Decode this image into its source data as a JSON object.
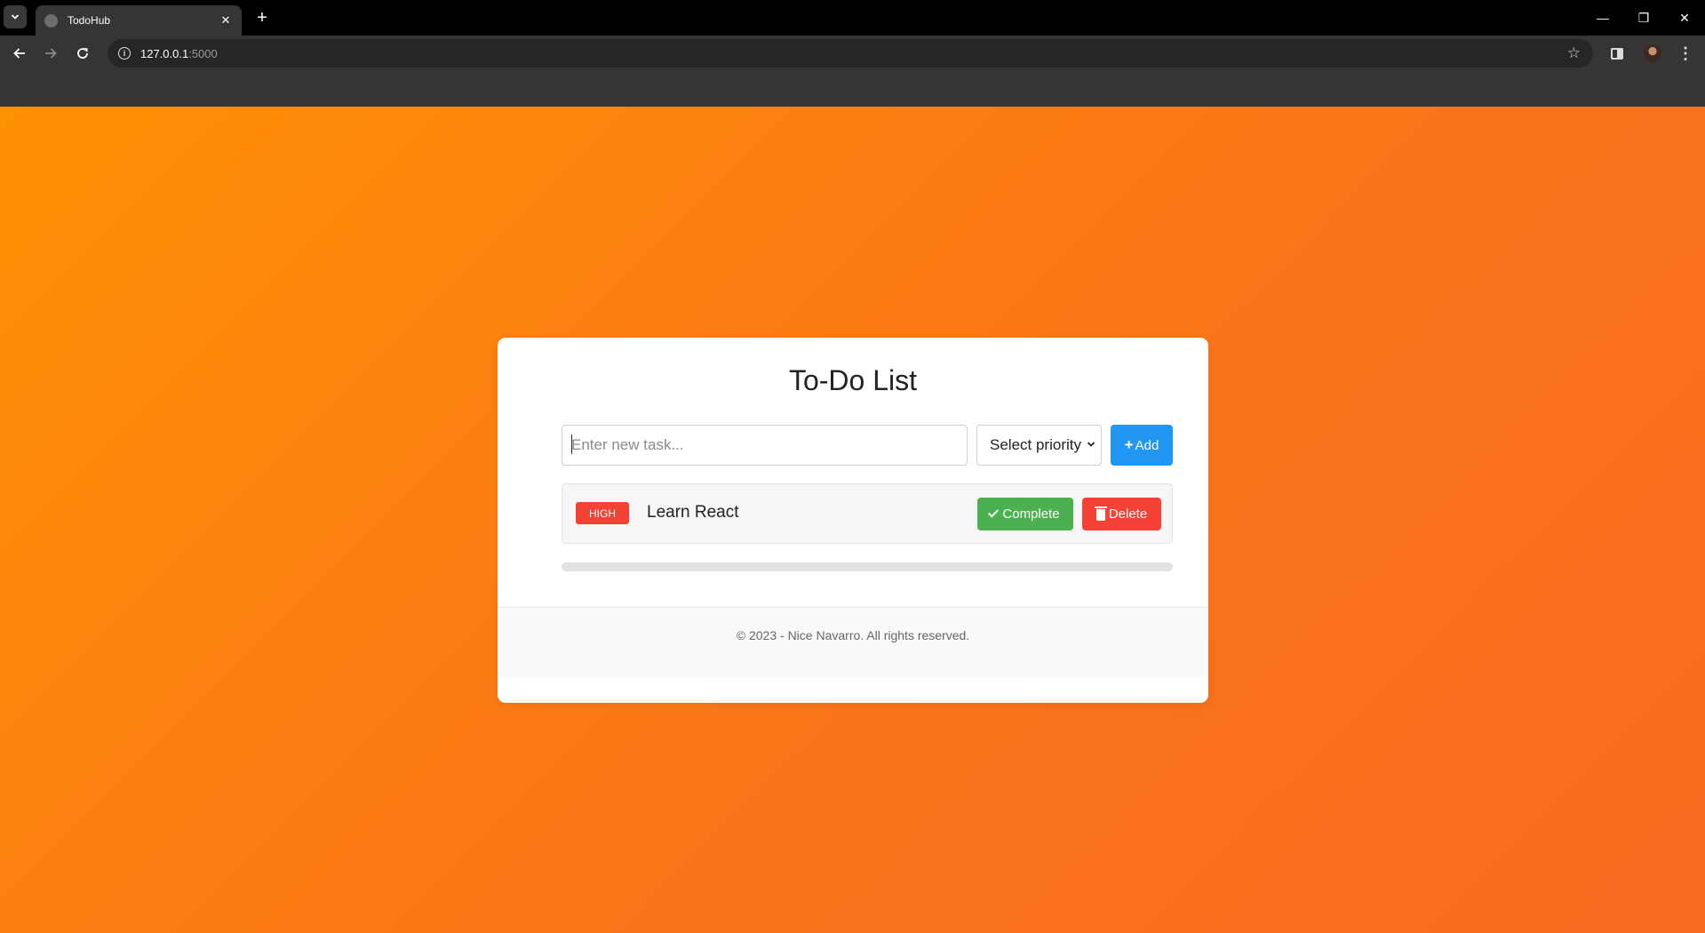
{
  "browser": {
    "tab_title": "TodoHub",
    "url_host": "127.0.0.1",
    "url_port": ":5000"
  },
  "app": {
    "title": "To-Do List",
    "task_input_placeholder": "Enter new task...",
    "priority_select_value": "Select priority",
    "add_label": "Add",
    "tasks": [
      {
        "priority_label": "HIGH",
        "text": "Learn React",
        "complete_label": "Complete",
        "delete_label": "Delete"
      }
    ],
    "progress_fraction": 0,
    "footer": "© 2023 - Nice Navarro. All rights reserved."
  },
  "colors": {
    "gradient_start": "#fe9004",
    "gradient_end": "#f86a21",
    "add_button": "#2196f3",
    "complete_button": "#4caf50",
    "delete_button": "#f44336",
    "badge_high": "#f44336"
  }
}
